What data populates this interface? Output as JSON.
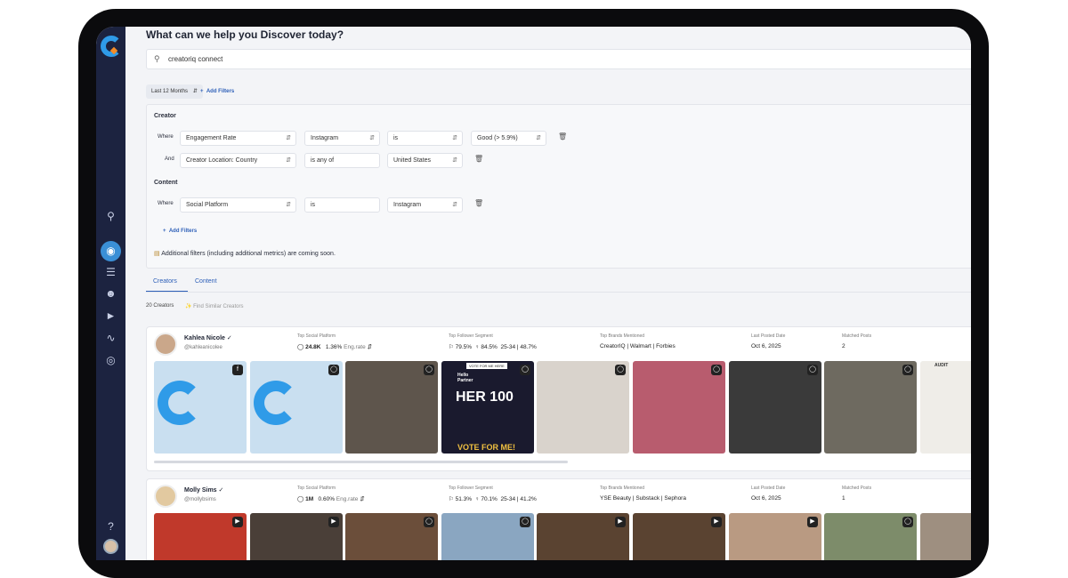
{
  "header": {
    "title": "What can we help you Discover today?"
  },
  "search": {
    "value": "creatoriq connect"
  },
  "toolbar": {
    "date_range": "Last 12 Months",
    "add_filters": "Add Filters"
  },
  "filters": {
    "creator_heading": "Creator",
    "creator_rows": [
      {
        "conj": "Where",
        "field": "Engagement Rate",
        "op": "Instagram",
        "cond": "is",
        "value": "Good (> 5.9%)"
      },
      {
        "conj": "And",
        "field": "Creator Location: Country",
        "op": "is any of",
        "value": "United States"
      }
    ],
    "content_heading": "Content",
    "content_rows": [
      {
        "conj": "Where",
        "field": "Social Platform",
        "op": "is",
        "value": "Instagram"
      }
    ],
    "add_filters": "Add Filters",
    "notice": "Additional filters (including additional metrics) are coming soon."
  },
  "tabs": {
    "creators": "Creators",
    "content": "Content"
  },
  "results": {
    "count": "20 Creators",
    "find_similar": "Find Similar Creators"
  },
  "metric_headers": {
    "platform": "Top Social Platform",
    "segment": "Top Follower Segment",
    "brands": "Top Brands Mentioned",
    "last_posted": "Last Posted Date",
    "matched": "Matched Posts"
  },
  "creators": [
    {
      "name": "Kahlea Nicole",
      "handle": "@kahleanicolee",
      "followers": "24.8K",
      "eng_rate": "1.36%",
      "eng_label": "Eng.rate",
      "segment_us": "79.5%",
      "segment_female": "84.5%",
      "segment_age": "25-34 | 48.7%",
      "brands": "CreatorIQ | Walmart | Forbies",
      "last_posted": "Oct 6, 2025",
      "matched": "2"
    },
    {
      "name": "Molly Sims",
      "handle": "@mollybsims",
      "followers": "1M",
      "eng_rate": "0.60%",
      "eng_label": "Eng.rate",
      "segment_us": "51.3%",
      "segment_female": "70.1%",
      "segment_age": "25-34 | 41.2%",
      "brands": "YSE Beauty | Substack | Sephora",
      "last_posted": "Oct 6, 2025",
      "matched": "1"
    }
  ],
  "thumb_texts": {
    "vote_top": "VOTE FOR ME HERE",
    "hello": "Hello Partner",
    "her100": "HER 100",
    "vote_bottom": "VOTE FOR ME!",
    "audit": "AUDIT"
  },
  "colors": {
    "sidebar": "#1c2340",
    "accent": "#2d5fb8",
    "brand_blue": "#2f9be8"
  }
}
